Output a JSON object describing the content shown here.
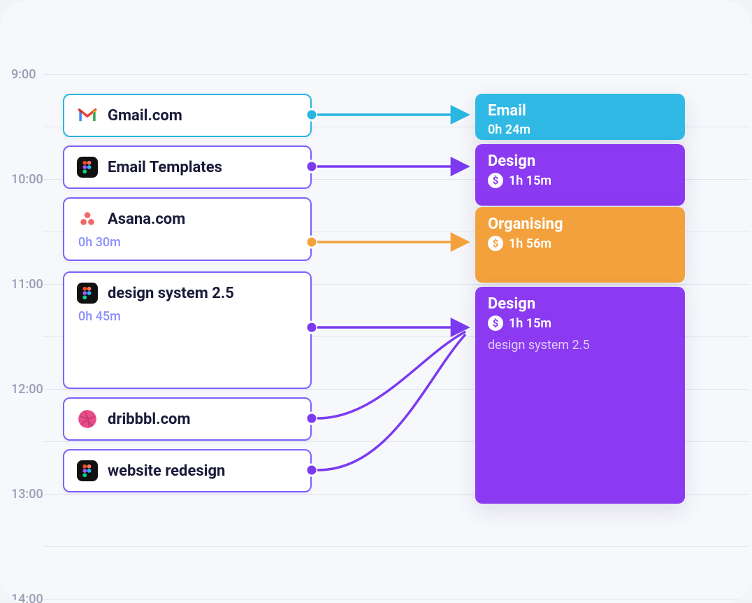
{
  "timeline": {
    "labels": [
      "9:00",
      "10:00",
      "11:00",
      "12:00",
      "13:00",
      "14:00"
    ]
  },
  "activities": [
    {
      "id": "gmail",
      "icon": "gmail-icon",
      "title": "Gmail.com",
      "duration": ""
    },
    {
      "id": "figma1",
      "icon": "figma-icon",
      "title": "Email Templates",
      "duration": ""
    },
    {
      "id": "asana",
      "icon": "asana-icon",
      "title": "Asana.com",
      "duration": "0h 30m"
    },
    {
      "id": "figma2",
      "icon": "figma-icon",
      "title": "design system 2.5",
      "duration": "0h 45m"
    },
    {
      "id": "dribbble",
      "icon": "dribbble-icon",
      "title": "dribbbl.com",
      "duration": ""
    },
    {
      "id": "figma3",
      "icon": "figma-icon",
      "title": "website redesign",
      "duration": ""
    }
  ],
  "categories": [
    {
      "id": "email",
      "title": "Email",
      "duration": "0h 24m",
      "billable": false,
      "note": "",
      "color": "#2fb9e4"
    },
    {
      "id": "design1",
      "title": "Design",
      "duration": "1h 15m",
      "billable": true,
      "note": "",
      "color": "#8b3af2"
    },
    {
      "id": "organising",
      "title": "Organising",
      "duration": "1h 56m",
      "billable": true,
      "note": "",
      "color": "#f3a13c"
    },
    {
      "id": "design2",
      "title": "Design",
      "duration": "1h 15m",
      "billable": true,
      "note": "design system 2.5",
      "color": "#8b3af2"
    }
  ]
}
